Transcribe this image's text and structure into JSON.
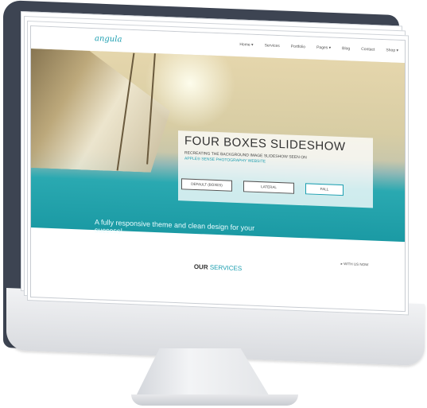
{
  "site": {
    "logo": "angula",
    "nav": [
      "Home ▾",
      "Services",
      "Portfolio",
      "Pages ▾",
      "Blog",
      "Contact",
      "Shop ▾"
    ]
  },
  "hero": {
    "title": "FOUR BOXES SLIDESHOW",
    "subtitle_line1": "RECREATING THE BACKGROUND IMAGE SLIDESHOW SEEN ON",
    "subtitle_line2": "APPLE® SENSE PHOTOGRAPHY WEBSITE",
    "buttons": [
      "DEFAULT (BOXES)",
      "LATERAL",
      "FALL"
    ]
  },
  "tagline": "A fully responsive theme and clean design for your success!",
  "cta_label": "▸ WITH US NOW",
  "services": {
    "bold": "OUR",
    "accent": "SERVICES"
  },
  "colors": {
    "accent": "#1b9eb0",
    "bezel": "#3d4452"
  }
}
